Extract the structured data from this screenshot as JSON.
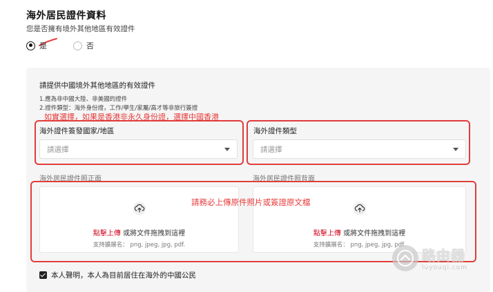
{
  "header": {
    "title": "海外居民證件資料",
    "question": "您是否擁有境外其他地區有效證件"
  },
  "radio": {
    "yes_label": "是",
    "no_label": "否",
    "selected": "yes"
  },
  "section": {
    "title": "請提供中國境外其他地區的有效證件",
    "note1": "1.應為非中國大陸、非美國的證件",
    "note2": "2.證件類型：海外身份證，工作/學生/家屬/高才等非旅行簽證"
  },
  "annotations": {
    "select_hint": "如實選擇，如果是香港非永久身份證，選擇中國香港",
    "upload_hint": "請務必上傳原件照片或簽證原文檔",
    "color": "#e83a3a"
  },
  "fields": {
    "country_label": "海外證件簽發國家/地區",
    "country_placeholder": "請選擇",
    "type_label": "海外證件類型",
    "type_placeholder": "請選擇"
  },
  "upload": {
    "front_label": "海外居民證件照正面",
    "back_label": "海外居民證件照背面",
    "click_text": "點擊上傳",
    "drag_text": " 或將文件拖拽到這裡",
    "ext_text": "支持擴展名： png, jpeg, jpg, pdf.",
    "link_color": "#d0021b"
  },
  "agreement": {
    "checked": true,
    "text": "本人聲明，本人為目前居住在海外的中國公民"
  },
  "watermark": {
    "main": "路由器",
    "sub": "luyouqi.com"
  }
}
